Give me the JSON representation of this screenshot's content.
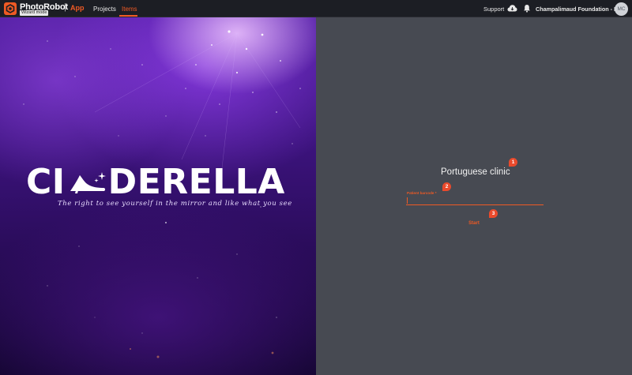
{
  "header": {
    "brand": "PhotoRobot",
    "separator": "|",
    "app_label": "App",
    "wizard_tag": "Wizard mode",
    "nav": [
      {
        "label": "Projects",
        "active": false
      },
      {
        "label": "Items",
        "active": true
      }
    ],
    "support_label": "Support",
    "organization": "Champalimaud Foundation - PINK",
    "avatar_initials": "MC",
    "icons": [
      "photorobot-logo-icon",
      "cloud-icon",
      "bell-icon"
    ]
  },
  "hero": {
    "title": "CINDERELLA",
    "title_left": "CI",
    "title_right": "DERELLA",
    "tagline": "The right to see yourself in the mirror and like what you see",
    "icon": "shoe-icon"
  },
  "wizard": {
    "title": "Portuguese clinic",
    "field_label": "Patient barcode *",
    "field_value": "",
    "start_label": "Start",
    "steps": [
      "1",
      "2",
      "3"
    ]
  },
  "colors": {
    "accent": "#ef5a24",
    "badge": "#ea4a2c",
    "topbar": "#1c1e24",
    "panel": "#474a52",
    "hero_dark": "#2a0c5a"
  }
}
